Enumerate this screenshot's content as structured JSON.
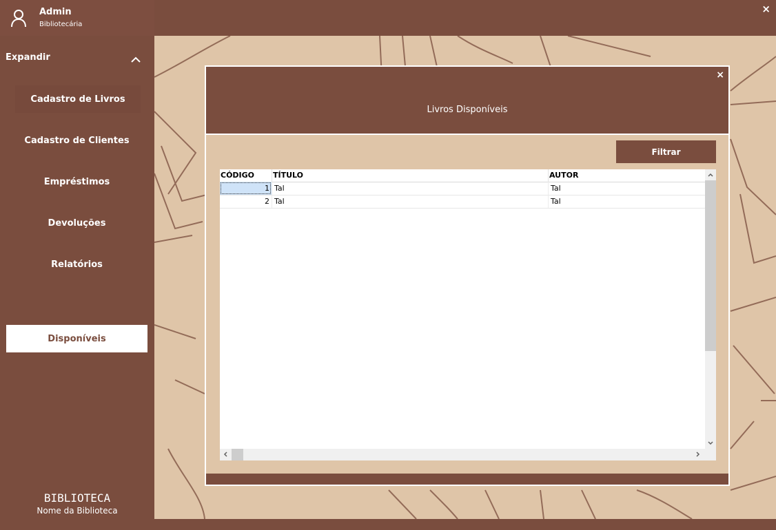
{
  "colors": {
    "primary": "#7a4d3e",
    "background": "#dfc5a8",
    "white": "#ffffff"
  },
  "user": {
    "name": "Admin",
    "role": "Bibliotecária",
    "icon": "user-icon"
  },
  "app": {
    "close_label": "×"
  },
  "sidebar": {
    "expand_label": "Expandir",
    "items": [
      {
        "label": "Cadastro de Livros"
      },
      {
        "label": "Cadastro de Clientes"
      },
      {
        "label": "Empréstimos"
      },
      {
        "label": "Devoluções"
      },
      {
        "label": "Relatórios"
      },
      {
        "label": "Disponíveis",
        "active": true
      }
    ],
    "brand_title": "BIBLIOTECA",
    "brand_subtitle": "Nome da Biblioteca"
  },
  "modal": {
    "title": "Livros Disponíveis",
    "close_label": "×",
    "filter_label": "Filtrar",
    "table": {
      "columns": [
        "CÓDIGO",
        "TÍTULO",
        "AUTOR"
      ],
      "rows": [
        {
          "code": "1",
          "title": "Tal",
          "author": "Tal"
        },
        {
          "code": "2",
          "title": "Tal",
          "author": "Tal"
        }
      ]
    }
  }
}
